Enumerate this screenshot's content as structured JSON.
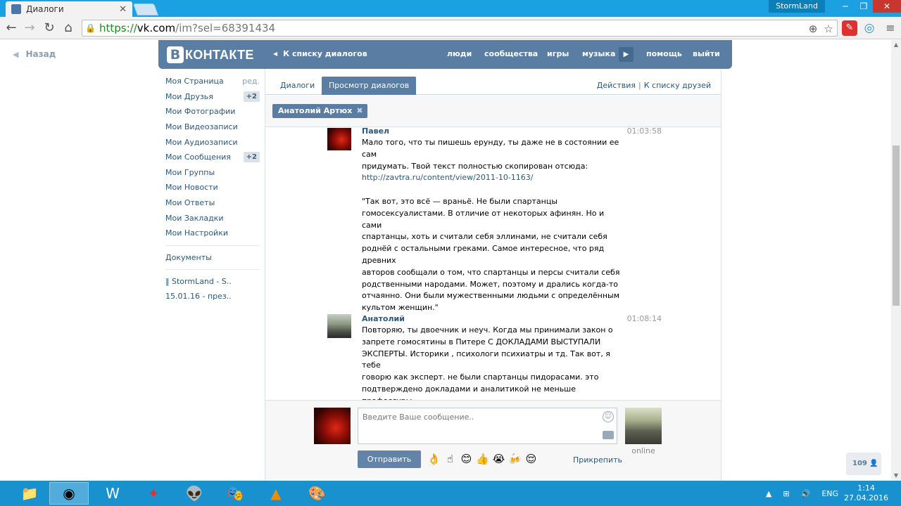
{
  "browser": {
    "tab_title": "Диалоги",
    "tab_close": "✕",
    "window_user": "StormLand",
    "url_proto": "https://",
    "url_host": "vk.com",
    "url_path": "/im?sel=68391434"
  },
  "page": {
    "back_label": "Назад",
    "header": {
      "logo_text": "КОНТАКТЕ",
      "to_list": "К списку диалогов",
      "nav": [
        "люди",
        "сообщества",
        "игры",
        "музыка",
        "помощь",
        "выйти"
      ]
    },
    "left_menu": {
      "items": [
        {
          "label": "Моя Страница",
          "extra": "ред."
        },
        {
          "label": "Мои Друзья",
          "badge": "+2"
        },
        {
          "label": "Мои Фотографии"
        },
        {
          "label": "Мои Видеозаписи"
        },
        {
          "label": "Мои Аудиозаписи"
        },
        {
          "label": "Мои Сообщения",
          "badge": "+2"
        },
        {
          "label": "Мои Группы"
        },
        {
          "label": "Мои Новости"
        },
        {
          "label": "Мои Ответы"
        },
        {
          "label": "Мои Закладки"
        },
        {
          "label": "Мои Настройки"
        }
      ],
      "documents": "Документы",
      "sub_items": [
        "‖ StormLand - S..",
        "15.01.16 - през.."
      ]
    },
    "tabs": {
      "dialogs": "Диалоги",
      "view": "Просмотр диалогов",
      "actions": "Действия",
      "friends": "К списку друзей"
    },
    "filter_chip": "Анатолий Артюх",
    "messages": [
      {
        "author": "Павел",
        "time": "01:03:58",
        "text_before": "Мало того, что ты пишешь ерунду, ты даже не в состоянии ее сам\nпридумать. Твой текст полностью скопирован отсюда:\n",
        "link": "http://zavtra.ru/content/view/2011-10-1163/",
        "text_after": "\n\n\"Так вот, это всё — враньё. Не были спартанцы\nгомосексуалистами. В отличие от некоторых афинян. Но и сами\nспартанцы, хоть и считали себя эллинами, не считали себя\nроднёй с остальными греками. Самое интересное, что ряд древних\nавторов сообщали о том, что спартанцы и персы считали себя\nродственными народами. Может, поэтому и дрались когда-то\nотчаянно. Они были мужественными людьми с определённым\nкультом женщин.\""
      },
      {
        "author": "Анатолий",
        "time": "01:08:14",
        "text": "Повторяю, ты двоечник и неуч. Когда мы принимали закон о\nзапрете гомосятины в Питере С ДОКЛАДАМИ ВЫСТУПАЛИ\nЭКСПЕРТЫ. Историки , психологи психиатры и тд. Так вот, я тебе\nговорю как эксперт. не были спартанцы пидорасами. это\nподтверждено докладами и аналитикой не меньше профессуры.\nПризнайся что туп, убери пост и не позорься!"
      }
    ],
    "composer": {
      "placeholder": "Введите Ваше сообщение..",
      "send": "Отправить",
      "attach": "Прикрепить",
      "peer_status": "online",
      "emojis": [
        "👌",
        "☝",
        "😊",
        "👍",
        "😭",
        "🍻",
        "😌"
      ]
    },
    "counter": "109"
  },
  "taskbar": {
    "lang": "ENG",
    "time": "1:14",
    "date": "27.04.2016"
  }
}
